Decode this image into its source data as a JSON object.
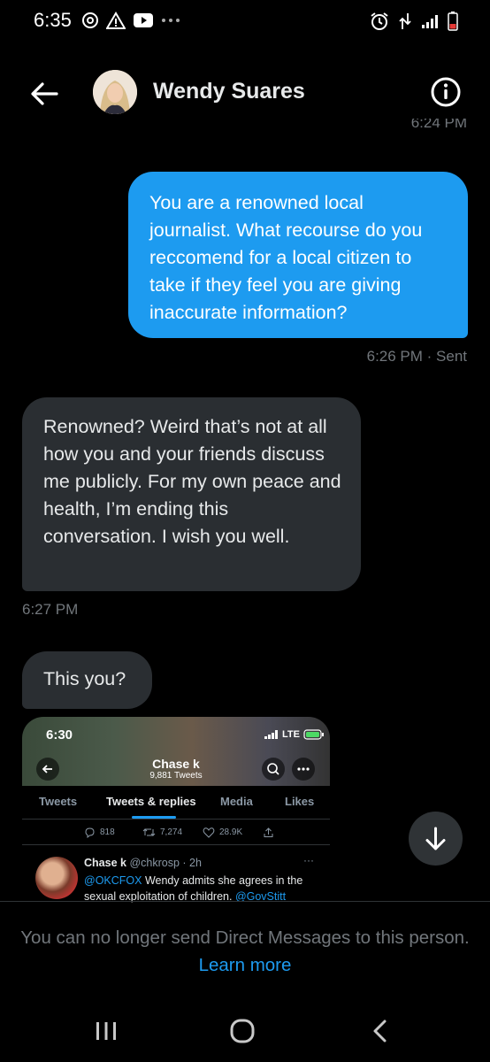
{
  "status_bar": {
    "time": "6:35",
    "left_icons": [
      "headphones-icon",
      "warning-icon",
      "youtube-icon",
      "more-notifications-icon"
    ],
    "right_icons": [
      "alarm-icon",
      "data-transfer-icon",
      "signal-icon",
      "battery-icon"
    ]
  },
  "header": {
    "name": "Wendy Suares",
    "cut_time": "6:24 PM"
  },
  "messages": [
    {
      "direction": "sent",
      "text": "You are a renowned local journalist. What recourse do you reccomend for a local citizen to take if they feel you are giving inaccurate information?",
      "meta": "6:26 PM · Sent"
    },
    {
      "direction": "received",
      "text": "Renowned? Weird that’s not at all how you and your friends discuss me publicly. For my own peace and health, I’m ending this conversation. I wish you well.",
      "meta": "6:27 PM"
    },
    {
      "direction": "received",
      "text": "This you?"
    }
  ],
  "embed": {
    "time": "6:30",
    "network": "LTE",
    "profile_name": "Chase k",
    "tweet_count": "9,881 Tweets",
    "tabs": [
      "Tweets",
      "Tweets & replies",
      "Media",
      "Likes"
    ],
    "active_tab": "Tweets & replies",
    "actions": {
      "replies": "818",
      "retweets": "7,274",
      "likes": "28.9K"
    },
    "tweet": {
      "author": "Chase k",
      "handle": "@chkrosp · 2h",
      "mention": "@OKCFOX",
      "text": " Wendy admits she agrees in the sexual exploitation of children. ",
      "mention2": "@GovStitt"
    }
  },
  "notice": {
    "text": "You can no longer send Direct Messages to this person. ",
    "link": "Learn more"
  },
  "colors": {
    "accent": "#1d9bf0",
    "received_bubble": "#2a2e32",
    "muted_text": "#71767b"
  }
}
